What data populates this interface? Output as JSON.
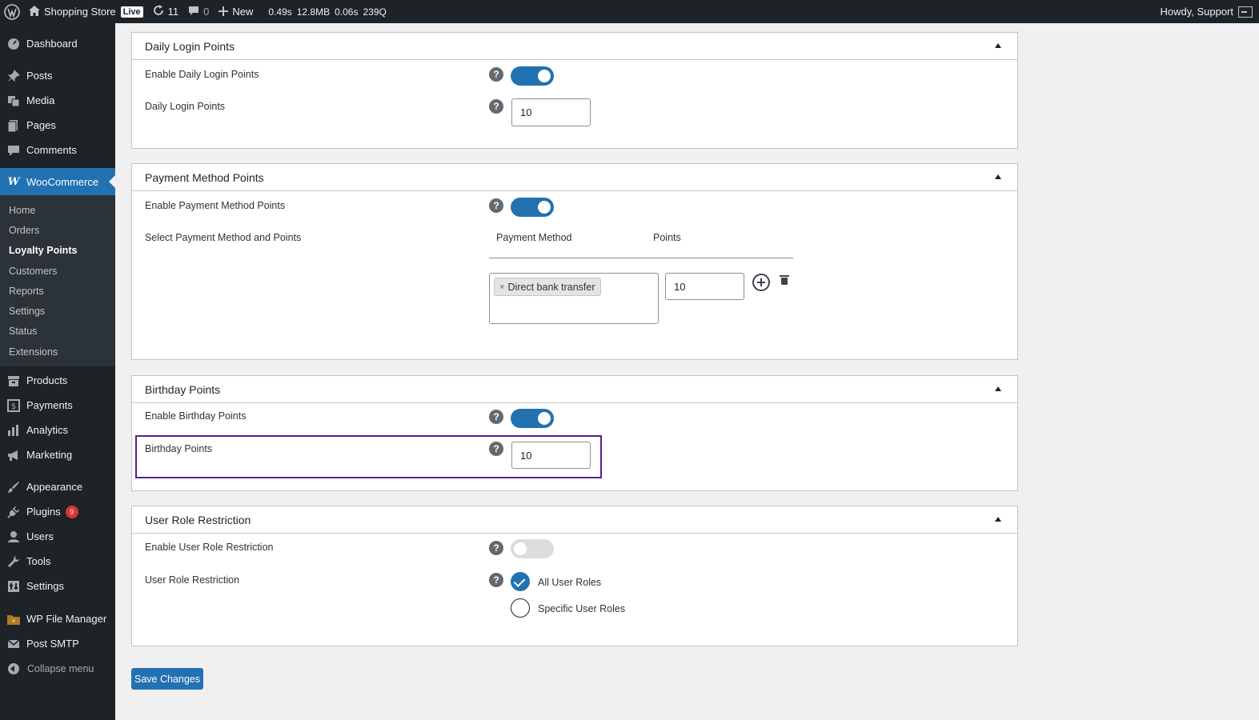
{
  "adminbar": {
    "site_name": "Shopping Store",
    "live_badge": "Live",
    "updates_count": "11",
    "comments_count": "0",
    "new_label": "New",
    "stat_time": "0.49s",
    "stat_memory": "12.8MB",
    "stat_query_time": "0.06s",
    "stat_queries": "239Q",
    "greeting": "Howdy, Support"
  },
  "sidebar": {
    "dashboard": "Dashboard",
    "posts": "Posts",
    "media": "Media",
    "pages": "Pages",
    "comments": "Comments",
    "woocommerce": "WooCommerce",
    "woocommerce_icon": "W",
    "submenu": [
      "Home",
      "Orders",
      "Loyalty Points",
      "Customers",
      "Reports",
      "Settings",
      "Status",
      "Extensions"
    ],
    "products": "Products",
    "payments": "Payments",
    "analytics": "Analytics",
    "marketing": "Marketing",
    "appearance": "Appearance",
    "plugins": "Plugins",
    "plugins_badge": "9",
    "users": "Users",
    "tools": "Tools",
    "settings": "Settings",
    "wp_file_manager": "WP File Manager",
    "post_smtp": "Post SMTP",
    "collapse": "Collapse menu"
  },
  "daily_login": {
    "title": "Daily Login Points",
    "enable_label": "Enable Daily Login Points",
    "enabled": true,
    "points_label": "Daily Login Points",
    "points_value": "10"
  },
  "payment_method": {
    "title": "Payment Method Points",
    "enable_label": "Enable Payment Method Points",
    "enabled": true,
    "select_label": "Select Payment Method and Points",
    "col_method": "Payment Method",
    "col_points": "Points",
    "chip_remove": "×",
    "selected_method": "Direct bank transfer",
    "points_value": "10"
  },
  "birthday": {
    "title": "Birthday Points",
    "enable_label": "Enable Birthday Points",
    "enabled": true,
    "points_label": "Birthday Points",
    "points_value": "10"
  },
  "role_restriction": {
    "title": "User Role Restriction",
    "enable_label": "Enable User Role Restriction",
    "enabled": false,
    "restriction_label": "User Role Restriction",
    "option_all": "All User Roles",
    "option_specific": "Specific User Roles",
    "selected": "All User Roles"
  },
  "help_glyph": "?",
  "save_label": "Save Changes",
  "colors": {
    "accent": "#2271b1",
    "sidebar_bg": "#1d2327",
    "highlight_border": "#5b1f8e",
    "badge": "#d63638"
  }
}
